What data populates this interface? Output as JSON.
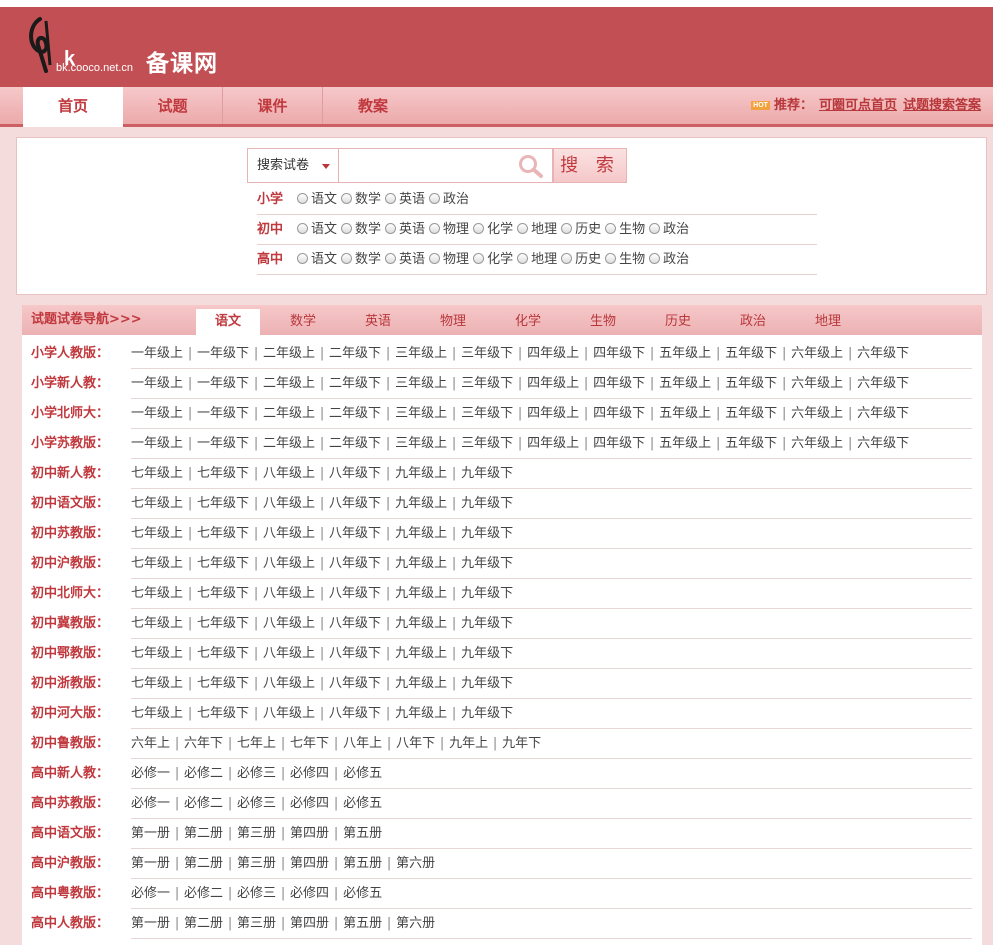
{
  "header": {
    "logo_url": "bk.cooco.net.cn",
    "logo_name": "备课网"
  },
  "nav": {
    "tabs": [
      "首页",
      "试题",
      "课件",
      "教案"
    ],
    "active": 0,
    "hot_badge": "HOT",
    "recommend_label": "推荐：",
    "links": [
      "可圈可点首页",
      "试题搜索答案"
    ]
  },
  "search": {
    "select_value": "搜索试卷",
    "input_value": "",
    "button_label": "搜 索",
    "grades": [
      {
        "label": "小学",
        "subjects": [
          "语文",
          "数学",
          "英语",
          "政治"
        ]
      },
      {
        "label": "初中",
        "subjects": [
          "语文",
          "数学",
          "英语",
          "物理",
          "化学",
          "地理",
          "历史",
          "生物",
          "政治"
        ]
      },
      {
        "label": "高中",
        "subjects": [
          "语文",
          "数学",
          "英语",
          "物理",
          "化学",
          "地理",
          "历史",
          "生物",
          "政治"
        ]
      }
    ]
  },
  "guide": {
    "title": "试题试卷导航>>>",
    "tabs": [
      "语文",
      "数学",
      "英语",
      "物理",
      "化学",
      "生物",
      "历史",
      "政治",
      "地理"
    ],
    "active_tab": 0,
    "rows": [
      {
        "label": "小学人教版：",
        "links": [
          "一年级上",
          "一年级下",
          "二年级上",
          "二年级下",
          "三年级上",
          "三年级下",
          "四年级上",
          "四年级下",
          "五年级上",
          "五年级下",
          "六年级上",
          "六年级下"
        ]
      },
      {
        "label": "小学新人教：",
        "links": [
          "一年级上",
          "一年级下",
          "二年级上",
          "二年级下",
          "三年级上",
          "三年级下",
          "四年级上",
          "四年级下",
          "五年级上",
          "五年级下",
          "六年级上",
          "六年级下"
        ]
      },
      {
        "label": "小学北师大：",
        "links": [
          "一年级上",
          "一年级下",
          "二年级上",
          "二年级下",
          "三年级上",
          "三年级下",
          "四年级上",
          "四年级下",
          "五年级上",
          "五年级下",
          "六年级上",
          "六年级下"
        ]
      },
      {
        "label": "小学苏教版：",
        "links": [
          "一年级上",
          "一年级下",
          "二年级上",
          "二年级下",
          "三年级上",
          "三年级下",
          "四年级上",
          "四年级下",
          "五年级上",
          "五年级下",
          "六年级上",
          "六年级下"
        ]
      },
      {
        "label": "初中新人教：",
        "links": [
          "七年级上",
          "七年级下",
          "八年级上",
          "八年级下",
          "九年级上",
          "九年级下"
        ]
      },
      {
        "label": "初中语文版：",
        "links": [
          "七年级上",
          "七年级下",
          "八年级上",
          "八年级下",
          "九年级上",
          "九年级下"
        ]
      },
      {
        "label": "初中苏教版：",
        "links": [
          "七年级上",
          "七年级下",
          "八年级上",
          "八年级下",
          "九年级上",
          "九年级下"
        ]
      },
      {
        "label": "初中沪教版：",
        "links": [
          "七年级上",
          "七年级下",
          "八年级上",
          "八年级下",
          "九年级上",
          "九年级下"
        ]
      },
      {
        "label": "初中北师大：",
        "links": [
          "七年级上",
          "七年级下",
          "八年级上",
          "八年级下",
          "九年级上",
          "九年级下"
        ]
      },
      {
        "label": "初中冀教版：",
        "links": [
          "七年级上",
          "七年级下",
          "八年级上",
          "八年级下",
          "九年级上",
          "九年级下"
        ]
      },
      {
        "label": "初中鄂教版：",
        "links": [
          "七年级上",
          "七年级下",
          "八年级上",
          "八年级下",
          "九年级上",
          "九年级下"
        ]
      },
      {
        "label": "初中浙教版：",
        "links": [
          "七年级上",
          "七年级下",
          "八年级上",
          "八年级下",
          "九年级上",
          "九年级下"
        ]
      },
      {
        "label": "初中河大版：",
        "links": [
          "七年级上",
          "七年级下",
          "八年级上",
          "八年级下",
          "九年级上",
          "九年级下"
        ]
      },
      {
        "label": "初中鲁教版：",
        "links": [
          "六年上",
          "六年下",
          "七年上",
          "七年下",
          "八年上",
          "八年下",
          "九年上",
          "九年下"
        ]
      },
      {
        "label": "高中新人教：",
        "links": [
          "必修一",
          "必修二",
          "必修三",
          "必修四",
          "必修五"
        ]
      },
      {
        "label": "高中苏教版：",
        "links": [
          "必修一",
          "必修二",
          "必修三",
          "必修四",
          "必修五"
        ]
      },
      {
        "label": "高中语文版：",
        "links": [
          "第一册",
          "第二册",
          "第三册",
          "第四册",
          "第五册"
        ]
      },
      {
        "label": "高中沪教版：",
        "links": [
          "第一册",
          "第二册",
          "第三册",
          "第四册",
          "第五册",
          "第六册"
        ]
      },
      {
        "label": "高中粤教版：",
        "links": [
          "必修一",
          "必修二",
          "必修三",
          "必修四",
          "必修五"
        ]
      },
      {
        "label": "高中人教版：",
        "links": [
          "第一册",
          "第二册",
          "第三册",
          "第四册",
          "第五册",
          "第六册"
        ]
      }
    ]
  },
  "colors": {
    "brand": "#c14f53",
    "accent_text": "#c0393e",
    "background": "#f4dcdc"
  }
}
